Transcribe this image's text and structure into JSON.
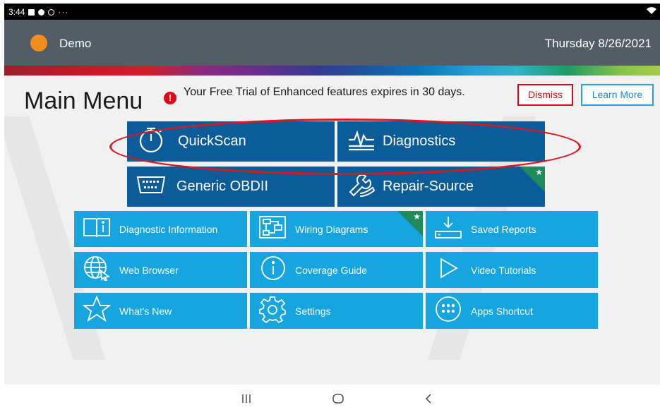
{
  "status_bar": {
    "time": "3:44",
    "overflow": "···",
    "icons": [
      "image-icon",
      "bag-icon",
      "sync-icon",
      "wifi-icon"
    ]
  },
  "header": {
    "profile_name": "Demo",
    "date": "Thursday 8/26/2021",
    "accent_color": "#f28c1b",
    "background_color": "#545d66"
  },
  "main": {
    "title": "Main Menu",
    "trial_notice": "Your Free Trial of Enhanced features expires in 30 days.",
    "dismiss_label": "Dismiss",
    "learn_more_label": "Learn More"
  },
  "primary_tiles": [
    {
      "label": "QuickScan",
      "icon": "stopwatch-icon"
    },
    {
      "label": "Diagnostics",
      "icon": "waveform-icon"
    },
    {
      "label": "Generic OBDII",
      "icon": "obd-connector-icon"
    },
    {
      "label": "Repair-Source",
      "icon": "wrench-hand-icon",
      "badge": "star-icon"
    }
  ],
  "secondary_tiles": [
    {
      "label": "Diagnostic Information",
      "icon": "book-info-icon"
    },
    {
      "label": "Wiring Diagrams",
      "icon": "wiring-diagram-icon",
      "badge": "star-icon"
    },
    {
      "label": "Saved Reports",
      "icon": "download-tray-icon"
    },
    {
      "label": "Web Browser",
      "icon": "globe-cursor-icon"
    },
    {
      "label": "Coverage Guide",
      "icon": "info-circle-icon"
    },
    {
      "label": "Video Tutorials",
      "icon": "play-icon"
    },
    {
      "label": "What's New",
      "icon": "star-outline-icon"
    },
    {
      "label": "Settings",
      "icon": "gear-icon"
    },
    {
      "label": "Apps Shortcut",
      "icon": "apps-grid-icon"
    }
  ],
  "colors": {
    "primary_tile": "#0b5c98",
    "secondary_tile": "#16a5df",
    "alert_red": "#e00716",
    "highlight_oval": "#e2141c",
    "new_badge": "#1f8a5b"
  },
  "nav_bar": {
    "recent_icon": "recent-apps-icon",
    "home_icon": "home-icon",
    "back_icon": "back-icon"
  }
}
